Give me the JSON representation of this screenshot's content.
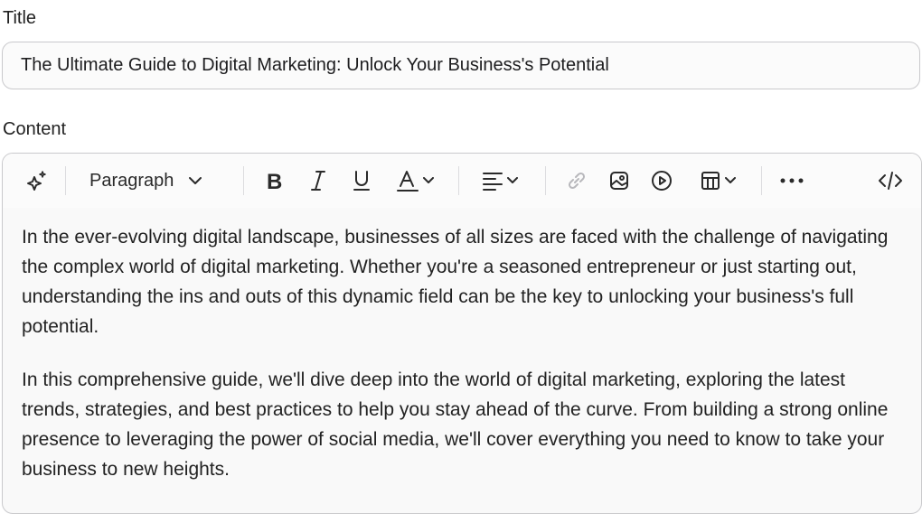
{
  "title": {
    "label": "Title",
    "value": "The Ultimate Guide to Digital Marketing: Unlock Your Business's Potential"
  },
  "content": {
    "label": "Content",
    "toolbar": {
      "block_type": "Paragraph",
      "icons": [
        "ai-assist-icon",
        "chevron-down-icon",
        "bold-icon",
        "italic-icon",
        "underline-icon",
        "text-color-icon",
        "align-icon",
        "link-icon",
        "image-icon",
        "video-icon",
        "table-icon",
        "more-icon",
        "code-view-icon"
      ]
    },
    "paragraphs": [
      "In the ever-evolving digital landscape, businesses of all sizes are faced with the challenge of navigating the complex world of digital marketing. Whether you're a seasoned entrepreneur or just starting out, understanding the ins and outs of this dynamic field can be the key to unlocking your business's full potential.",
      "In this comprehensive guide, we'll dive deep into the world of digital marketing, exploring the latest trends, strategies, and best practices to help you stay ahead of the curve. From building a strong online presence to leveraging the power of social media, we'll cover everything you need to know to take your business to new heights."
    ]
  }
}
